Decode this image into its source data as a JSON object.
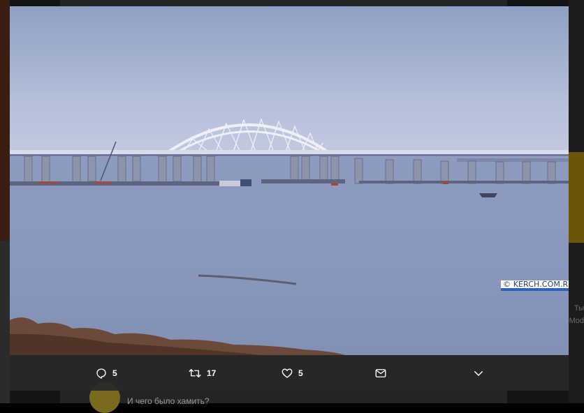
{
  "photo": {
    "description_icon": "bridge-photo",
    "watermark": "© KERCH.COM.RU"
  },
  "actions": {
    "reply": {
      "icon": "reply-bubble-icon",
      "count": "5"
    },
    "retweet": {
      "icon": "retweet-icon",
      "count": "17"
    },
    "like": {
      "icon": "heart-icon",
      "count": "5"
    },
    "dm": {
      "icon": "envelope-icon"
    },
    "more": {
      "icon": "chevron-down-icon"
    }
  },
  "background": {
    "reply_text": "И чего было хамить?",
    "side_text_1": "Ты",
    "side_text_2": "Mod"
  },
  "colors": {
    "overlay": "#151515",
    "action_bar": "#282828",
    "icon": "#ffffff"
  }
}
